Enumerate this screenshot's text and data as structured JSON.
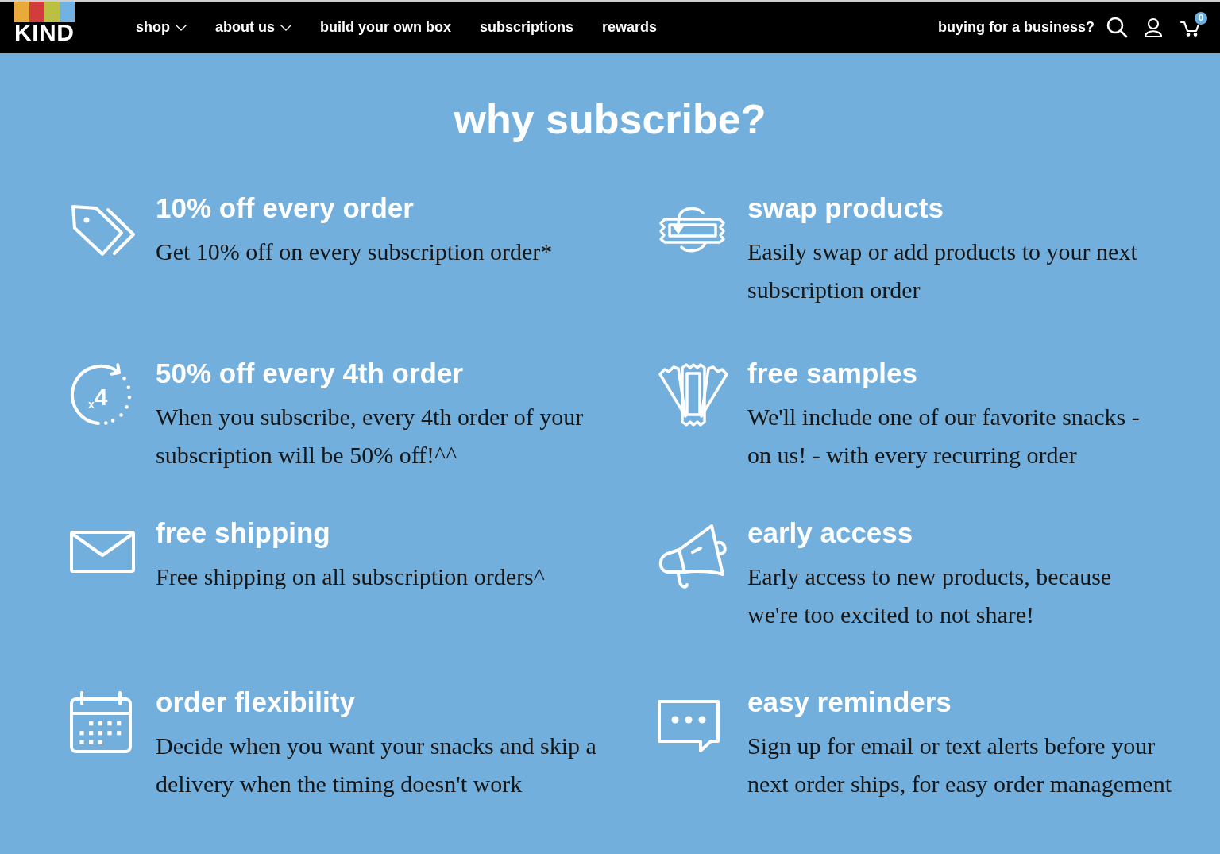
{
  "header": {
    "logo": "KIND",
    "nav": [
      {
        "label": "shop",
        "dropdown": true
      },
      {
        "label": "about us",
        "dropdown": true
      },
      {
        "label": "build your own box",
        "dropdown": false
      },
      {
        "label": "subscriptions",
        "dropdown": false
      },
      {
        "label": "rewards",
        "dropdown": false
      }
    ],
    "business_link": "buying for a business?",
    "cart_count": "0"
  },
  "title": "why subscribe?",
  "features": [
    {
      "kind": "tag",
      "title": "10% off every order",
      "text": "Get 10% off on every subscription order*"
    },
    {
      "kind": "swap",
      "title": "swap products",
      "text": "Easily swap or add products to your next subscription order"
    },
    {
      "kind": "repeat",
      "title": "50% off every 4th order",
      "icon_text": "$_{x}$4",
      "text": "When you subscribe, every 4th order of your subscription will be 50% off!^^"
    },
    {
      "kind": "samples",
      "title": "free samples",
      "text": "We'll include one of our favorite snacks - on us! - with every recurring order"
    },
    {
      "kind": "envelope",
      "title": "free shipping",
      "text": "Free shipping on all subscription orders^"
    },
    {
      "kind": "megaphone",
      "title": "early access",
      "text": "Early access to new products, because we're too excited to not share!"
    },
    {
      "kind": "calendar",
      "title": "order flexibility",
      "text": "Decide when you want your snacks and skip a delivery when the timing doesn't work"
    },
    {
      "kind": "chat",
      "title": "easy reminders",
      "text": "Sign up for email or text alerts before your next order ships, for easy order management"
    }
  ]
}
